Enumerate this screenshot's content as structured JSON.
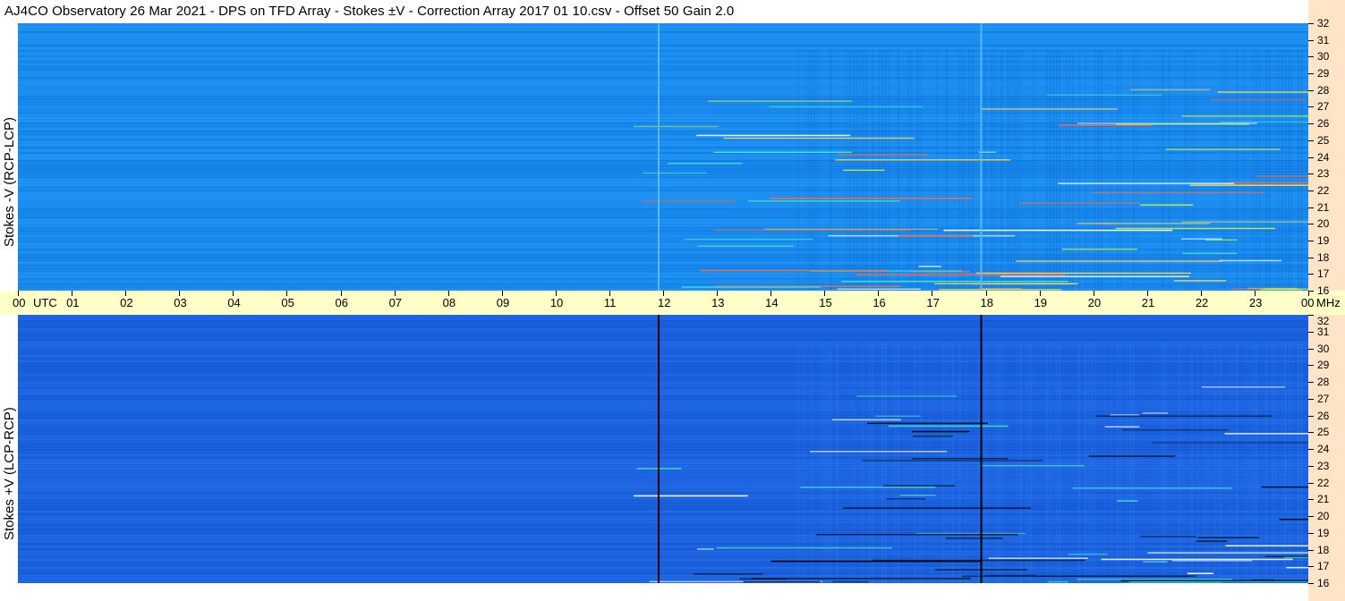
{
  "title": "AJ4CO Observatory  26 Mar 2021  -  DPS on TFD Array  -  Stokes ±V  -  Correction Array 2017 01 10.csv  -  Offset 50  Gain 2.0",
  "chart_data": [
    {
      "type": "heatmap",
      "panel": "top",
      "ylabel": "Stokes -V (RCP-LCP)",
      "x_ticks": [
        "00",
        "01",
        "02",
        "03",
        "04",
        "05",
        "06",
        "07",
        "08",
        "09",
        "10",
        "11",
        "12",
        "13",
        "14",
        "15",
        "16",
        "17",
        "18",
        "19",
        "20",
        "21",
        "22",
        "23",
        "00"
      ],
      "x_unit": "UTC",
      "y_ticks": [
        32,
        31,
        30,
        29,
        28,
        27,
        26,
        25,
        24,
        23,
        22,
        21,
        20,
        19,
        18,
        17,
        16
      ],
      "y_unit": "MHz",
      "ylim": [
        16,
        32
      ],
      "xlim": [
        0,
        24
      ],
      "markers_utc": [
        11.9,
        17.9
      ],
      "colormap": "blue"
    },
    {
      "type": "heatmap",
      "panel": "bottom",
      "ylabel": "Stokes +V (LCP-RCP)",
      "x_ticks": [
        "00",
        "01",
        "02",
        "03",
        "04",
        "05",
        "06",
        "07",
        "08",
        "09",
        "10",
        "11",
        "12",
        "13",
        "14",
        "15",
        "16",
        "17",
        "18",
        "19",
        "20",
        "21",
        "22",
        "23",
        "00"
      ],
      "x_unit": "UTC",
      "y_ticks": [
        32,
        31,
        30,
        29,
        28,
        27,
        26,
        25,
        24,
        23,
        22,
        21,
        20,
        19,
        18,
        17,
        16
      ],
      "y_unit": "MHz",
      "ylim": [
        16,
        32
      ],
      "xlim": [
        0,
        24
      ],
      "markers_utc": [
        11.9,
        17.9
      ],
      "colormap": "blue"
    }
  ],
  "axis": {
    "utc_label": "UTC",
    "mhz_label": "MHz"
  },
  "colors": {
    "top_bg": "#1a8cf0",
    "bottom_bg": "#1c62e0",
    "time_axis_bg": "#ffffc8",
    "freq_axis_bg": "#ffe4c8"
  }
}
